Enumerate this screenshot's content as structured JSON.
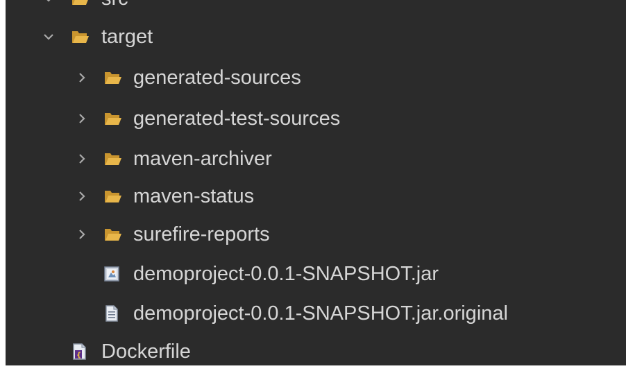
{
  "tree": {
    "items": [
      {
        "label": "src",
        "icon": "folder-open-icon",
        "expanded": true
      },
      {
        "label": "target",
        "icon": "folder-open-icon",
        "expanded": true
      },
      {
        "label": "generated-sources",
        "icon": "folder-open-icon",
        "expanded": false
      },
      {
        "label": "generated-test-sources",
        "icon": "folder-open-icon",
        "expanded": false
      },
      {
        "label": "maven-archiver",
        "icon": "folder-open-icon",
        "expanded": false
      },
      {
        "label": "maven-status",
        "icon": "folder-open-icon",
        "expanded": false
      },
      {
        "label": "surefire-reports",
        "icon": "folder-open-icon",
        "expanded": false
      },
      {
        "label": "demoproject-0.0.1-SNAPSHOT.jar",
        "icon": "jar-file-icon"
      },
      {
        "label": "demoproject-0.0.1-SNAPSHOT.jar.original",
        "icon": "text-file-icon"
      },
      {
        "label": "Dockerfile",
        "icon": "dockerfile-icon"
      }
    ]
  },
  "colors": {
    "background": "#2b2b2b",
    "text": "#d6d6d6",
    "folder": "#e8b64a",
    "chevron": "#a9a9a9"
  }
}
